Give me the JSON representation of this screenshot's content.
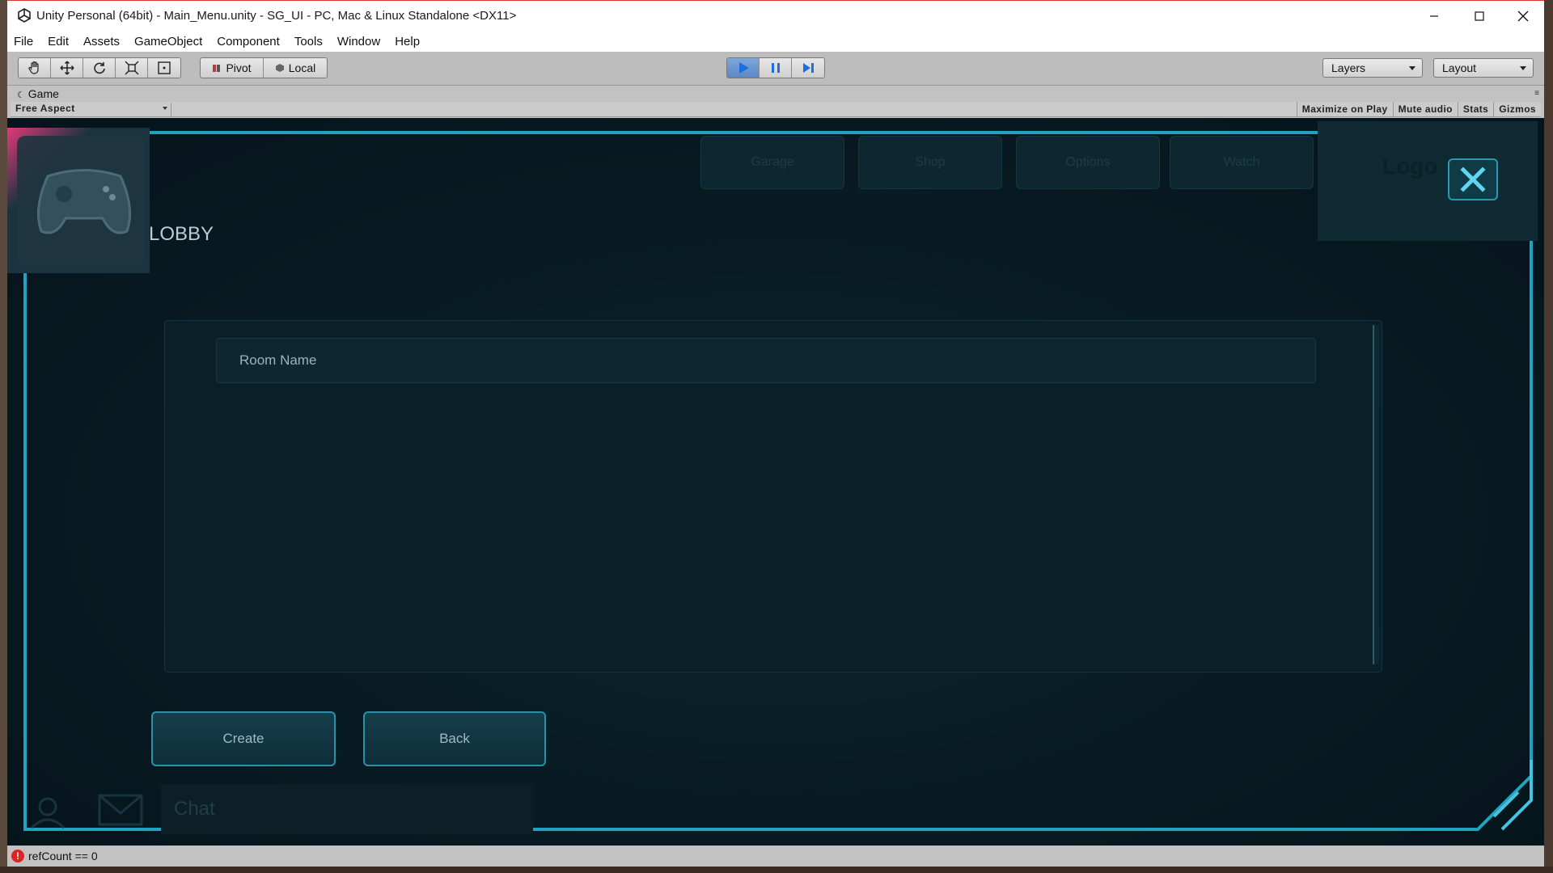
{
  "window": {
    "title": "Unity Personal (64bit) - Main_Menu.unity - SG_UI - PC, Mac & Linux Standalone <DX11>",
    "minimize": "—",
    "maximize": "☐",
    "close": "✕"
  },
  "menu": [
    "File",
    "Edit",
    "Assets",
    "GameObject",
    "Component",
    "Tools",
    "Window",
    "Help"
  ],
  "toolbar": {
    "pivot_label": "Pivot",
    "local_label": "Local",
    "layers_label": "Layers",
    "layout_label": "Layout"
  },
  "game_tab": {
    "label": "Game",
    "aspect": "Free Aspect",
    "buttons": [
      "Maximize on Play",
      "Mute audio",
      "Stats",
      "Gizmos"
    ]
  },
  "game": {
    "title": "LOBBY",
    "nav": [
      "Garage",
      "Shop",
      "Options",
      "Watch"
    ],
    "logo_text": "Logo",
    "room_name_placeholder": "Room Name",
    "create_label": "Create",
    "back_label": "Back",
    "chat_label": "Chat"
  },
  "status": {
    "message": "refCount == 0"
  },
  "colors": {
    "accent": "#2a9ab0",
    "game_bg": "#08181f",
    "error": "#dd2222"
  }
}
